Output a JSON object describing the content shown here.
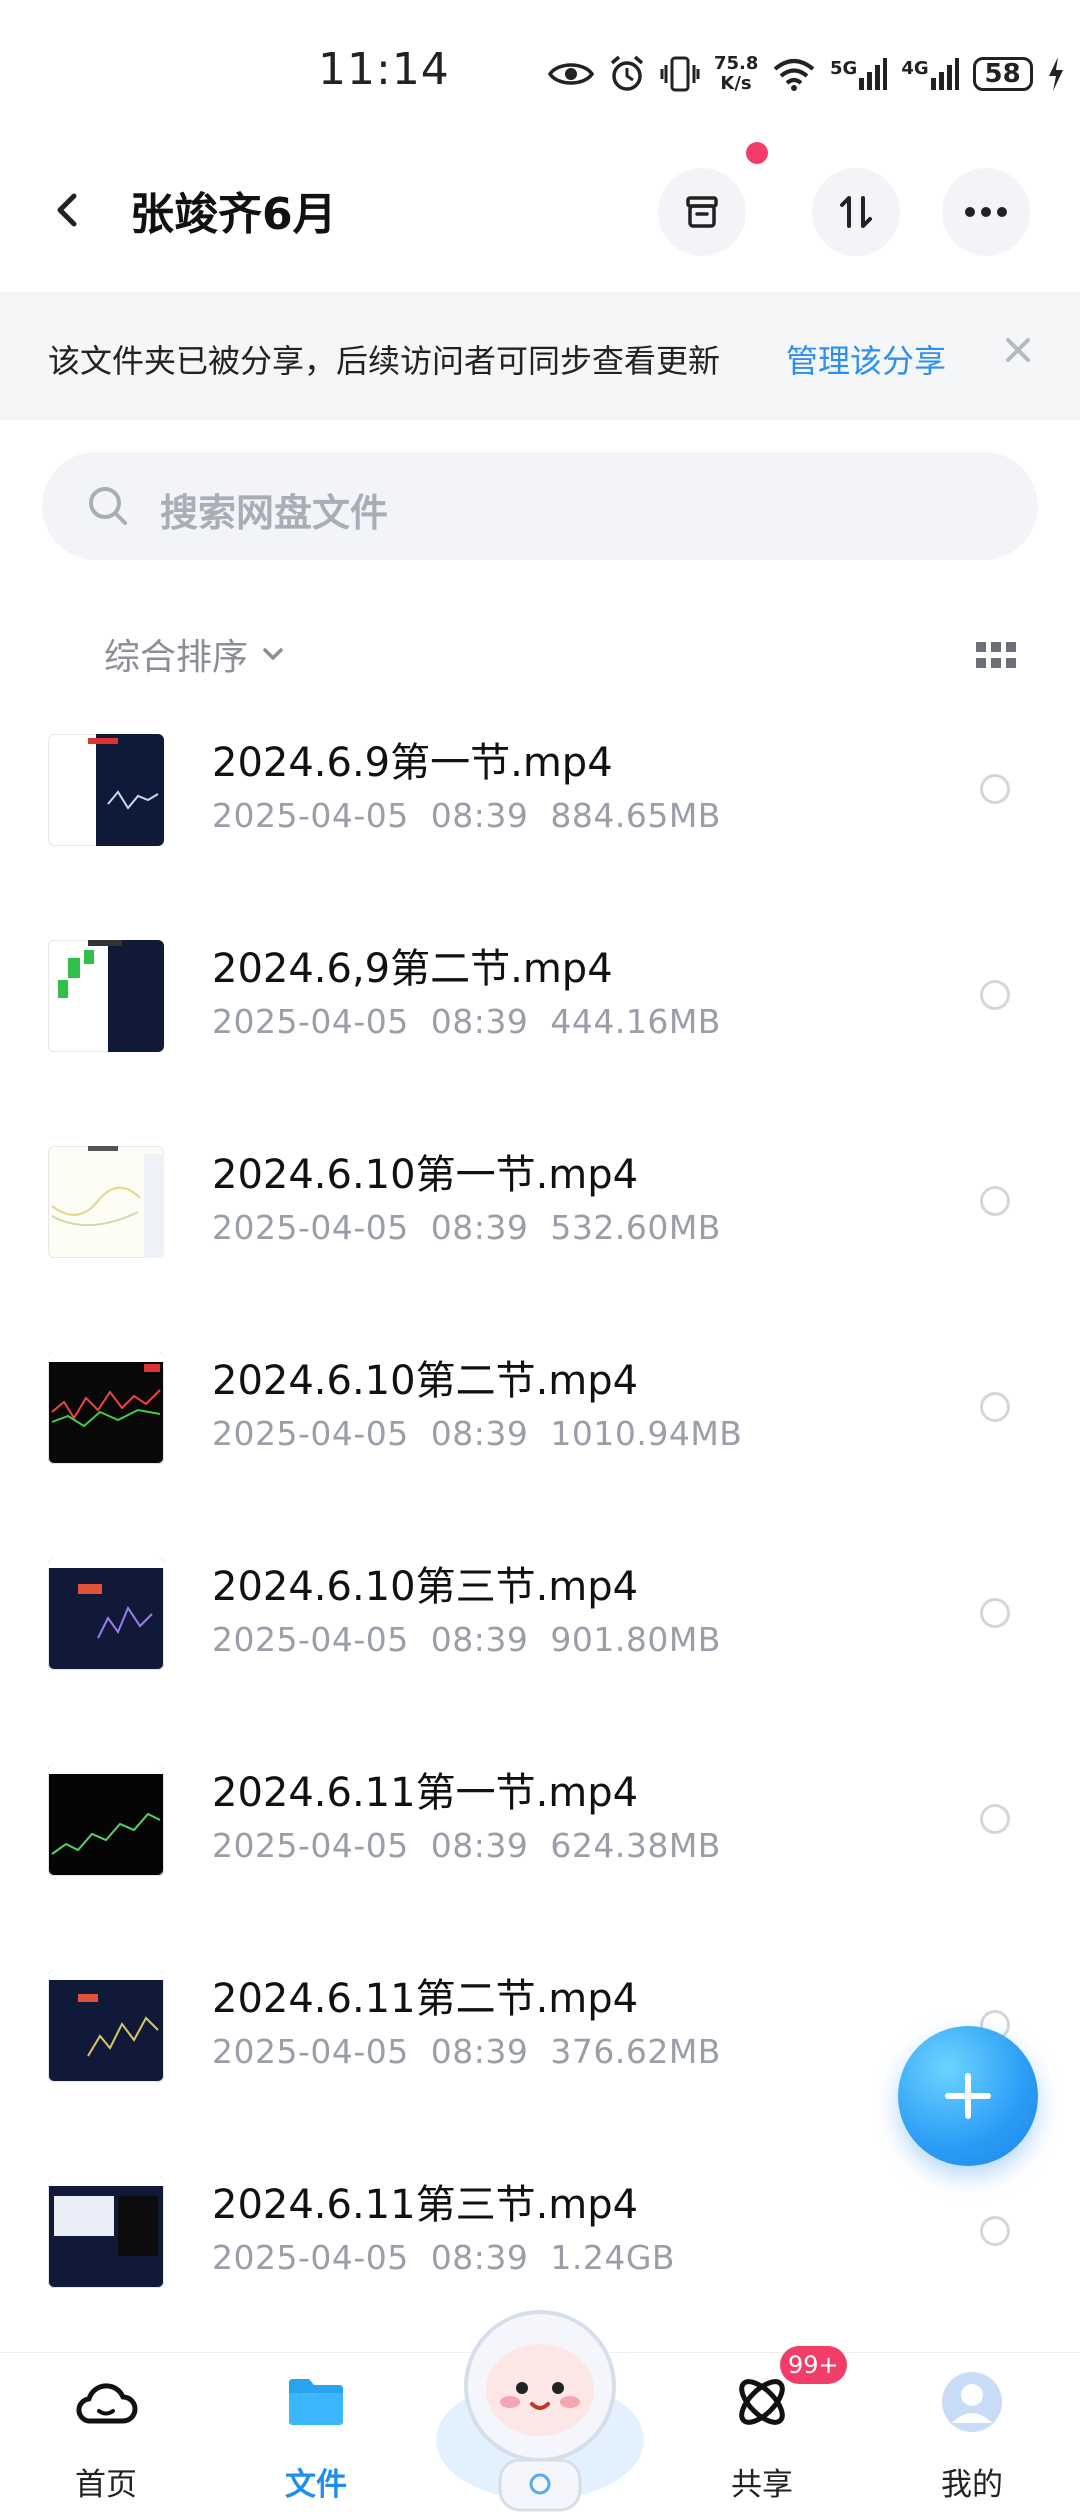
{
  "status_bar": {
    "time": "11:14",
    "net_speed_value": "75.8",
    "net_speed_unit": "K/s",
    "net1": "5G",
    "net2": "4G",
    "battery": "58"
  },
  "header": {
    "title": "张竣齐6月"
  },
  "share_banner": {
    "text": "该文件夹已被分享，后续访问者可同步查看更新",
    "link": "管理该分享"
  },
  "search": {
    "placeholder": "搜索网盘文件"
  },
  "sort": {
    "label": "综合排序"
  },
  "files": [
    {
      "name": "2024.6.9第一节.mp4",
      "date": "2025-04-05",
      "time": "08:39",
      "size": "884.65MB"
    },
    {
      "name": "2024.6,9第二节.mp4",
      "date": "2025-04-05",
      "time": "08:39",
      "size": "444.16MB"
    },
    {
      "name": "2024.6.10第一节.mp4",
      "date": "2025-04-05",
      "time": "08:39",
      "size": "532.60MB"
    },
    {
      "name": "2024.6.10第二节.mp4",
      "date": "2025-04-05",
      "time": "08:39",
      "size": "1010.94MB"
    },
    {
      "name": "2024.6.10第三节.mp4",
      "date": "2025-04-05",
      "time": "08:39",
      "size": "901.80MB"
    },
    {
      "name": "2024.6.11第一节.mp4",
      "date": "2025-04-05",
      "time": "08:39",
      "size": "624.38MB"
    },
    {
      "name": "2024.6.11第二节.mp4",
      "date": "2025-04-05",
      "time": "08:39",
      "size": "376.62MB"
    },
    {
      "name": "2024.6.11第三节.mp4",
      "date": "2025-04-05",
      "time": "08:39",
      "size": "1.24GB"
    }
  ],
  "nav": {
    "home": "首页",
    "files": "文件",
    "share": "共享",
    "share_badge": "99+",
    "mine": "我的"
  },
  "colors": {
    "accent": "#1f8ef1",
    "link": "#2d8ff0",
    "badge": "#f23d68"
  }
}
